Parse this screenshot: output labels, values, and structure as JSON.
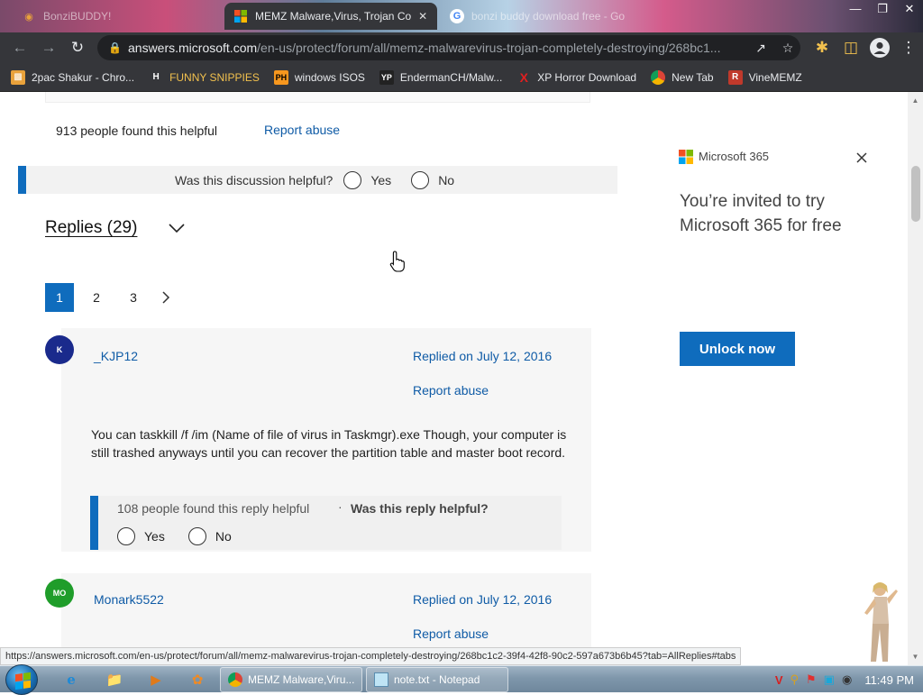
{
  "browser": {
    "tabs": [
      {
        "title": "BonziBUDDY!",
        "state": "inactive"
      },
      {
        "title": "MEMZ Malware,Virus, Trojan Co",
        "state": "active"
      },
      {
        "title": "bonzi buddy download free - Go",
        "state": "inactive"
      }
    ],
    "url_host": "answers.microsoft.com",
    "url_path": "/en-us/protect/forum/all/memz-malwarevirus-trojan-completely-destroying/268bc1..."
  },
  "bookmarks": [
    {
      "label": "2pac Shakur - Chro...",
      "icon": "bookmark-favicon",
      "color": "#e9a23b"
    },
    {
      "label": "FUNNY SNIPPIES",
      "icon": "h-favicon",
      "color": "#ffffff"
    },
    {
      "label": "windows ISOS",
      "icon": "ph-favicon",
      "color": "#f7971e"
    },
    {
      "label": "EndermanCH/Malw...",
      "icon": "yp-favicon",
      "color": "#222222"
    },
    {
      "label": "XP Horror Download",
      "icon": "x-favicon",
      "color": "#e02020"
    },
    {
      "label": "New Tab",
      "icon": "chrome-favicon",
      "color": "#b0b0b0"
    },
    {
      "label": "VineMEMZ",
      "icon": "r-favicon",
      "color": "#c0392b"
    }
  ],
  "page": {
    "helpful_count": "913 people found this helpful",
    "report_abuse": "Report abuse",
    "discussion_question": "Was this discussion helpful?",
    "yes": "Yes",
    "no": "No",
    "replies_heading": "Replies (29)",
    "pages": [
      "1",
      "2",
      "3"
    ],
    "current_page": "1",
    "replies": [
      {
        "avatar_initials": "K",
        "avatar_color": "#1a2a8c",
        "author": "_KJP12",
        "replied_on": "Replied on July 12, 2016",
        "report": "Report abuse",
        "body": "You can taskkill /f /im (Name of file of virus in Taskmgr).exe Though, your computer is still trashed anyways until you can recover the partition table and master boot record.",
        "helpful_count": "108 people found this reply helpful",
        "separator": "·",
        "helpful_question": "Was this reply helpful?",
        "yes": "Yes",
        "no": "No"
      },
      {
        "avatar_initials": "MO",
        "avatar_color": "#1f9d2a",
        "author": "Monark5522",
        "replied_on": "Replied on July 12, 2016",
        "report": "Report abuse"
      }
    ]
  },
  "ad": {
    "brand": "Microsoft 365",
    "headline": "You’re invited to try Microsoft 365 for free",
    "cta": "Unlock now"
  },
  "status_url": "https://answers.microsoft.com/en-us/protect/forum/all/memz-malwarevirus-trojan-completely-destroying/268bc1c2-39f4-42f8-90c2-597a673b6b45?tab=AllReplies#tabs",
  "taskbar": {
    "tasks": [
      {
        "label": "MEMZ Malware,Viru...",
        "icon": "chrome-icon"
      },
      {
        "label": "note.txt - Notepad",
        "icon": "notepad-icon"
      }
    ],
    "clock": "11:49 PM"
  },
  "colors": {
    "accent": "#0f6cbd",
    "link": "#0f5ba6"
  }
}
